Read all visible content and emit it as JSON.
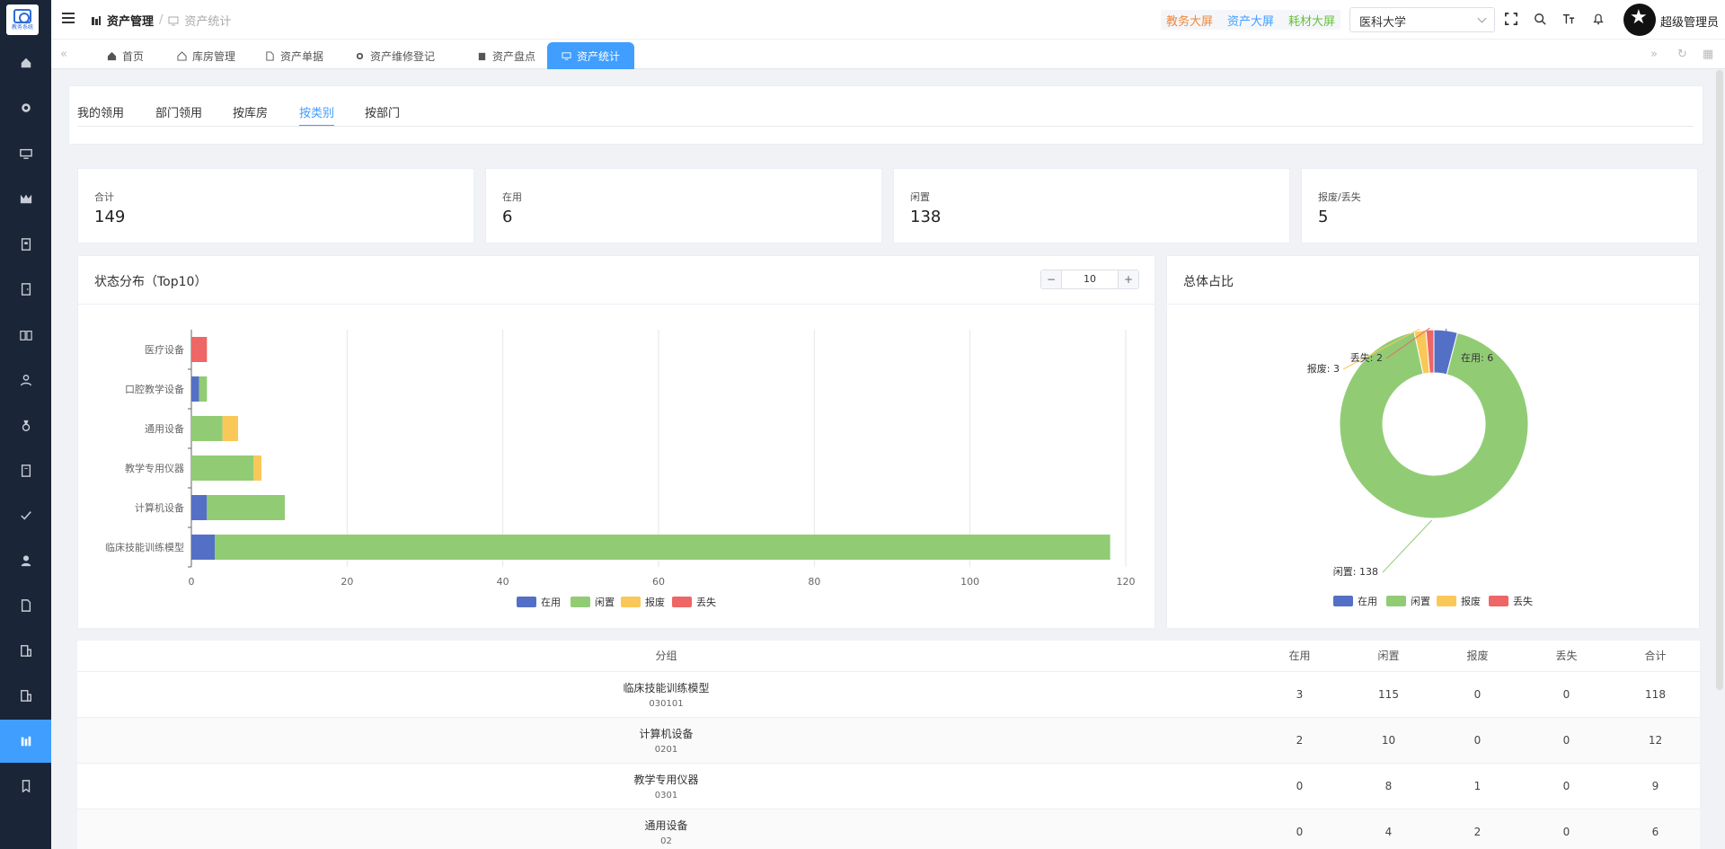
{
  "logo": {
    "text": "教务系统"
  },
  "sidebar": {
    "items": [
      {
        "icon": "home-icon"
      },
      {
        "icon": "gear-icon"
      },
      {
        "icon": "monitor-icon"
      },
      {
        "icon": "chart-icon"
      },
      {
        "icon": "building-icon"
      },
      {
        "icon": "door-icon"
      },
      {
        "icon": "book-icon"
      },
      {
        "icon": "user-icon"
      },
      {
        "icon": "medal-icon"
      },
      {
        "icon": "notebook-icon"
      },
      {
        "icon": "check-icon"
      },
      {
        "icon": "person-icon"
      },
      {
        "icon": "document-icon"
      },
      {
        "icon": "office-icon"
      },
      {
        "icon": "office-icon"
      },
      {
        "icon": "asset-stat-icon"
      },
      {
        "icon": "bookmark-icon"
      }
    ],
    "active_index": 15
  },
  "header": {
    "breadcrumb": [
      "资产管理",
      "资产统计"
    ],
    "links": [
      "教务大屏",
      "资产大屏",
      "耗材大屏"
    ],
    "org_select": "医科大学",
    "user_name": "超级管理员",
    "colors": {
      "link1": "#f0883a",
      "link2": "#409eff",
      "link3": "#67c23a"
    }
  },
  "tabs": [
    {
      "label": "首页",
      "icon": "home-icon"
    },
    {
      "label": "库房管理",
      "icon": "house-icon"
    },
    {
      "label": "资产单据",
      "icon": "document-icon"
    },
    {
      "label": "资产维修登记",
      "icon": "gear-icon"
    },
    {
      "label": "资产盘点",
      "icon": "clipboard-icon"
    },
    {
      "label": "资产统计",
      "icon": "monitor-icon",
      "active": true
    }
  ],
  "category_tabs": [
    "我的领用",
    "部门领用",
    "按库房",
    "按类别",
    "按部门"
  ],
  "active_category": "按类别",
  "stats": [
    {
      "label": "合计",
      "value": "149"
    },
    {
      "label": "在用",
      "value": "6"
    },
    {
      "label": "闲置",
      "value": "138"
    },
    {
      "label": "报废/丢失",
      "value": "5"
    }
  ],
  "status_card": {
    "title": "状态分布（Top10）",
    "stepper_value": "10"
  },
  "ratio_card": {
    "title": "总体占比"
  },
  "chart_data": [
    {
      "type": "bar",
      "orientation": "horizontal",
      "stacked": true,
      "categories": [
        "临床技能训练模型",
        "计算机设备",
        "教学专用仪器",
        "通用设备",
        "口腔教学设备",
        "医疗设备"
      ],
      "series": [
        {
          "name": "在用",
          "values": [
            3,
            2,
            0,
            0,
            1,
            0
          ],
          "color": "#5470c6"
        },
        {
          "name": "闲置",
          "values": [
            115,
            10,
            8,
            4,
            1,
            0
          ],
          "color": "#91cc75"
        },
        {
          "name": "报废",
          "values": [
            0,
            0,
            1,
            2,
            0,
            0
          ],
          "color": "#fac858"
        },
        {
          "name": "丢失",
          "values": [
            0,
            0,
            0,
            0,
            0,
            2
          ],
          "color": "#ee6666"
        }
      ],
      "xlim": [
        0,
        120
      ],
      "xticks": [
        0,
        20,
        40,
        60,
        80,
        100,
        120
      ],
      "grid": true,
      "legend": "bottom"
    },
    {
      "type": "pie",
      "donut": true,
      "slices": [
        {
          "name": "在用",
          "value": 6,
          "color": "#5470c6",
          "label": "在用: 6"
        },
        {
          "name": "闲置",
          "value": 138,
          "color": "#91cc75",
          "label": "闲置: 138"
        },
        {
          "name": "报废",
          "value": 3,
          "color": "#fac858",
          "label": "报废: 3"
        },
        {
          "name": "丢失",
          "value": 2,
          "color": "#ee6666",
          "label": "丢失: 2"
        }
      ],
      "legend": "bottom"
    }
  ],
  "table": {
    "headers": [
      "分组",
      "在用",
      "闲置",
      "报废",
      "丢失",
      "合计"
    ],
    "rows": [
      {
        "name": "临床技能训练模型",
        "code": "030101",
        "in_use": "3",
        "idle": "115",
        "scrap": "0",
        "lost": "0",
        "total": "118"
      },
      {
        "name": "计算机设备",
        "code": "0201",
        "in_use": "2",
        "idle": "10",
        "scrap": "0",
        "lost": "0",
        "total": "12"
      },
      {
        "name": "教学专用仪器",
        "code": "0301",
        "in_use": "0",
        "idle": "8",
        "scrap": "1",
        "lost": "0",
        "total": "9"
      },
      {
        "name": "通用设备",
        "code": "02",
        "in_use": "0",
        "idle": "4",
        "scrap": "2",
        "lost": "0",
        "total": "6"
      }
    ]
  }
}
